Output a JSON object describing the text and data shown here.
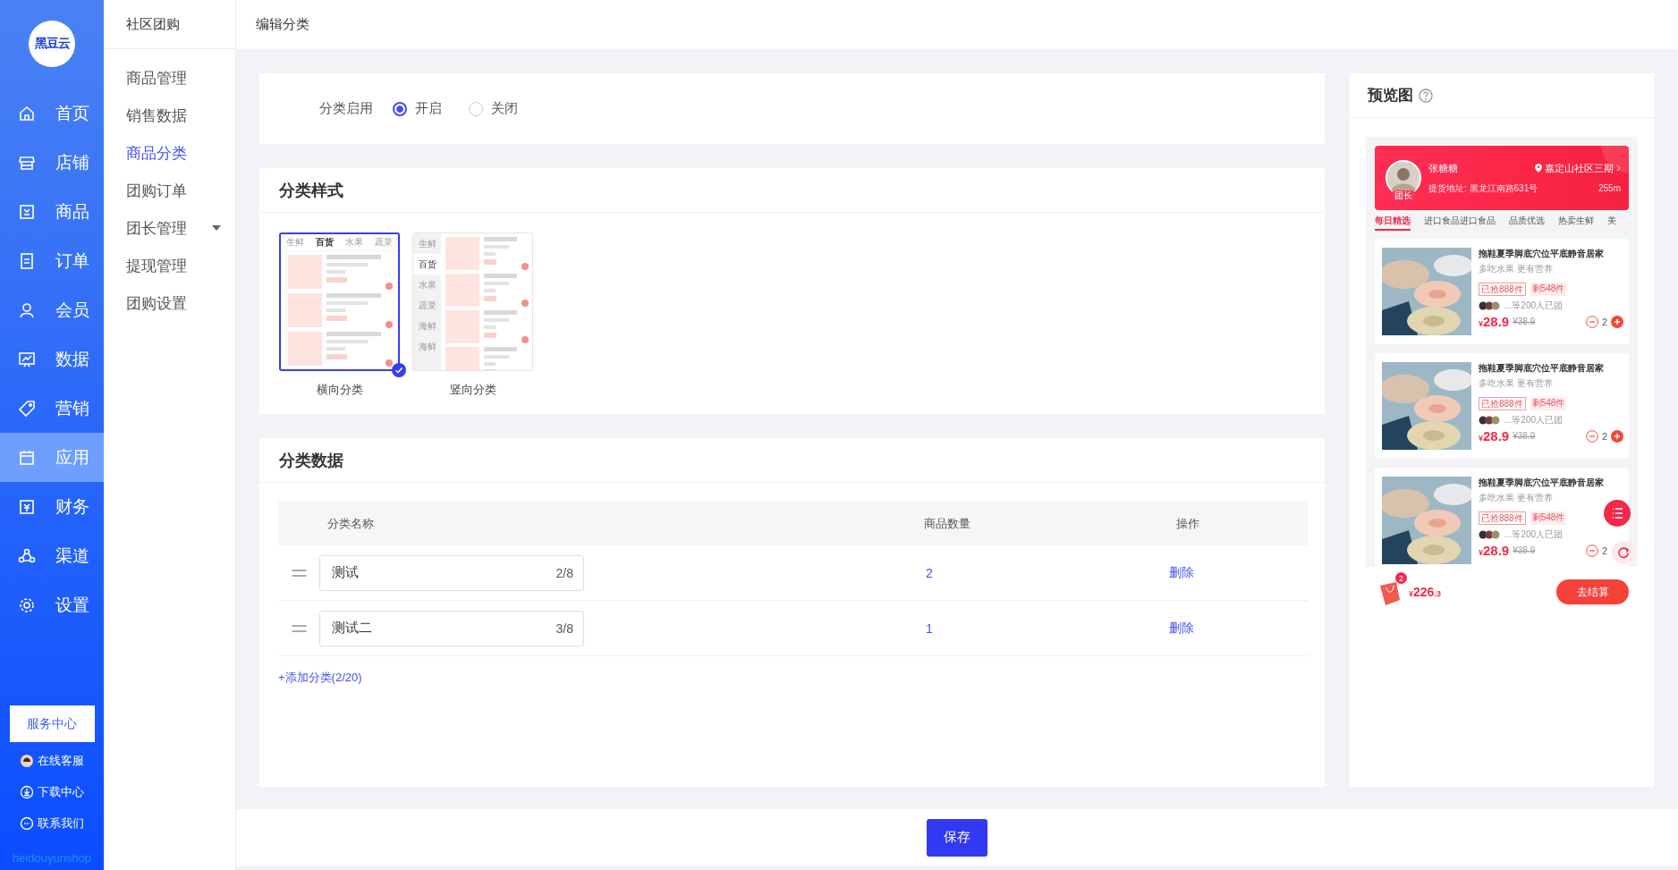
{
  "sidebar": {
    "logo": "黑豆云",
    "items": [
      {
        "label": "首页",
        "selected": false
      },
      {
        "label": "店铺",
        "selected": false
      },
      {
        "label": "商品",
        "selected": false
      },
      {
        "label": "订单",
        "selected": false
      },
      {
        "label": "会员",
        "selected": false
      },
      {
        "label": "数据",
        "selected": false
      },
      {
        "label": "营销",
        "selected": false
      },
      {
        "label": "应用",
        "selected": true
      },
      {
        "label": "财务",
        "selected": false
      },
      {
        "label": "渠道",
        "selected": false
      },
      {
        "label": "设置",
        "selected": false
      }
    ],
    "service_button": "服务中心",
    "links": [
      "在线客服",
      "下载中心",
      "联系我们"
    ],
    "brand": "heidouyunshop"
  },
  "subnav": {
    "title": "社区团购",
    "items": [
      {
        "label": "商品管理",
        "selected": false,
        "expandable": false
      },
      {
        "label": "销售数据",
        "selected": false,
        "expandable": false
      },
      {
        "label": "商品分类",
        "selected": true,
        "expandable": false
      },
      {
        "label": "团购订单",
        "selected": false,
        "expandable": false
      },
      {
        "label": "团长管理",
        "selected": false,
        "expandable": true
      },
      {
        "label": "提现管理",
        "selected": false,
        "expandable": false
      },
      {
        "label": "团购设置",
        "selected": false,
        "expandable": false
      }
    ]
  },
  "header": {
    "title": "编辑分类"
  },
  "enable": {
    "label": "分类启用",
    "options": [
      {
        "label": "开启",
        "selected": true
      },
      {
        "label": "关闭",
        "selected": false
      }
    ]
  },
  "style_section": {
    "title": "分类样式",
    "options": [
      {
        "label": "横向分类",
        "kind": "horizontal",
        "selected": true,
        "tabs": [
          {
            "label": "生鲜",
            "selected": false
          },
          {
            "label": "百货",
            "selected": true
          },
          {
            "label": "水果",
            "selected": false
          },
          {
            "label": "蔬菜",
            "selected": false
          }
        ]
      },
      {
        "label": "竖向分类",
        "kind": "vertical",
        "selected": false,
        "tabs": [
          {
            "label": "生鲜",
            "selected": false
          },
          {
            "label": "百货",
            "selected": true
          },
          {
            "label": "水果",
            "selected": false
          },
          {
            "label": "蔬菜",
            "selected": false
          },
          {
            "label": "海鲜",
            "selected": false
          },
          {
            "label": "海鲜",
            "selected": false
          }
        ]
      }
    ]
  },
  "data_section": {
    "title": "分类数据",
    "columns": [
      "分类名称",
      "商品数量",
      "操作"
    ],
    "rows": [
      {
        "name": "测试",
        "counter": "2/8",
        "quantity": "2",
        "action": "删除"
      },
      {
        "name": "测试二",
        "counter": "3/8",
        "quantity": "1",
        "action": "删除"
      }
    ],
    "add_link": "+添加分类(2/20)"
  },
  "save_button": "保存",
  "preview": {
    "title": "预览图",
    "leader": {
      "name": "张糖糖",
      "badge": "团长",
      "location": "嘉定山社区三期",
      "address": "提货地址: 黑龙江南路631号",
      "distance": "255m"
    },
    "tabs": [
      {
        "label": "每日精选",
        "selected": true
      },
      {
        "label": "进口食品进口食品",
        "selected": false
      },
      {
        "label": "品质优选",
        "selected": false
      },
      {
        "label": "热卖生鲜",
        "selected": false
      },
      {
        "label": "美",
        "selected": false
      }
    ],
    "products": [
      {
        "title": "拖鞋夏季脚底穴位平底静音居家",
        "subtitle": "多吃水果 更有营养",
        "sold": "已抢888件",
        "left": "剩548件",
        "group": "...等200人已团",
        "currency": "¥",
        "price": "28.9",
        "old_price": "¥38.9",
        "qty": "2",
        "plus_visible": true
      },
      {
        "title": "拖鞋夏季脚底穴位平底静音居家",
        "subtitle": "多吃水果 更有营养",
        "sold": "已抢888件",
        "left": "剩548件",
        "group": "...等200人已团",
        "currency": "¥",
        "price": "28.9",
        "old_price": "¥38.9",
        "qty": "2",
        "plus_visible": true
      },
      {
        "title": "拖鞋夏季脚底穴位平底静音居家",
        "subtitle": "多吃水果 更有营养",
        "sold": "已抢888件",
        "left": "剩548件",
        "group": "...等200人已团",
        "currency": "¥",
        "price": "28.9",
        "old_price": "¥38.9",
        "qty": "2",
        "plus_visible": false
      }
    ],
    "cart": {
      "badge": "2",
      "currency": "¥",
      "total": "226",
      "decimals": ".3",
      "checkout": "去结算"
    }
  }
}
